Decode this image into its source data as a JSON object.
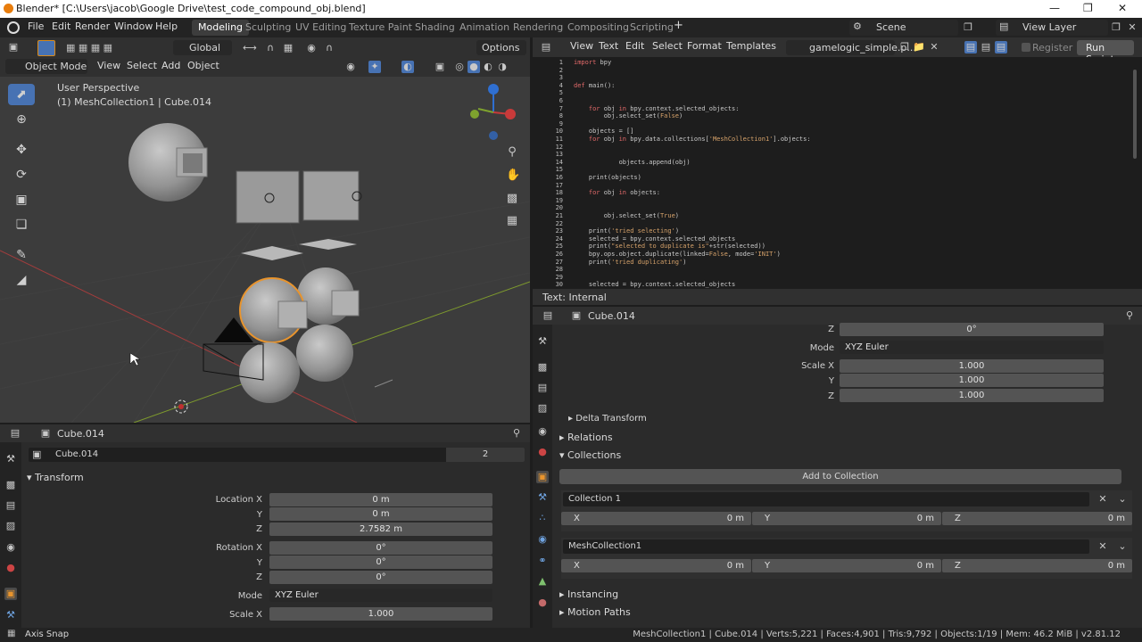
{
  "title": "Blender* [C:\\Users\\jacob\\Google Drive\\test_code_compound_obj.blend]",
  "menu": [
    "File",
    "Edit",
    "Render",
    "Window",
    "Help"
  ],
  "workspaces": [
    "Modeling",
    "Sculpting",
    "UV Editing",
    "Texture Paint",
    "Shading",
    "Animation",
    "Rendering",
    "Compositing",
    "Scripting"
  ],
  "scene": "Scene",
  "view_layer": "View Layer",
  "vp": {
    "orientation": "Global",
    "options": "Options",
    "mode": "Object Mode",
    "menus": [
      "View",
      "Select",
      "Add",
      "Object"
    ],
    "perspective": "User Perspective",
    "collection_line": "(1) MeshCollection1 | Cube.014"
  },
  "te": {
    "menus": [
      "View",
      "Text",
      "Edit",
      "Select",
      "Format",
      "Templates"
    ],
    "file": "gamelogic_simple.p...",
    "register": "Register",
    "run": "Run Script",
    "status": "Text: Internal"
  },
  "code": [
    {
      "n": "1",
      "t": "import bpy"
    },
    {
      "n": "2",
      "t": ""
    },
    {
      "n": "3",
      "t": ""
    },
    {
      "n": "4",
      "t": "def main():"
    },
    {
      "n": "5",
      "t": ""
    },
    {
      "n": "6",
      "t": ""
    },
    {
      "n": "7",
      "t": "    for obj in bpy.context.selected_objects:"
    },
    {
      "n": "8",
      "t": "        obj.select_set(False)"
    },
    {
      "n": "9",
      "t": ""
    },
    {
      "n": "10",
      "t": "    objects = []"
    },
    {
      "n": "11",
      "t": "    for obj in bpy.data.collections['MeshCollection1'].objects:"
    },
    {
      "n": "12",
      "t": ""
    },
    {
      "n": "13",
      "t": ""
    },
    {
      "n": "14",
      "t": "            objects.append(obj)"
    },
    {
      "n": "15",
      "t": ""
    },
    {
      "n": "16",
      "t": "    print(objects)"
    },
    {
      "n": "17",
      "t": ""
    },
    {
      "n": "18",
      "t": "    for obj in objects:"
    },
    {
      "n": "19",
      "t": ""
    },
    {
      "n": "20",
      "t": ""
    },
    {
      "n": "21",
      "t": "        obj.select_set(True)"
    },
    {
      "n": "22",
      "t": ""
    },
    {
      "n": "23",
      "t": "    print('tried selecting')"
    },
    {
      "n": "24",
      "t": "    selected = bpy.context.selected_objects"
    },
    {
      "n": "25",
      "t": "    print(\"selected to duplicate is\"+str(selected))"
    },
    {
      "n": "26",
      "t": "    bpy.ops.object.duplicate(linked=False, mode='INIT')"
    },
    {
      "n": "27",
      "t": "    print('tried duplicating')"
    },
    {
      "n": "28",
      "t": ""
    },
    {
      "n": "29",
      "t": ""
    },
    {
      "n": "30",
      "t": "    selected = bpy.context.selected_objects"
    }
  ],
  "props_right": {
    "object": "Cube.014",
    "z_label": "Z",
    "z_value": "0°",
    "mode_label": "Mode",
    "mode_value": "XYZ Euler",
    "scale": [
      {
        "label": "Scale X",
        "value": "1.000"
      },
      {
        "label": "Y",
        "value": "1.000"
      },
      {
        "label": "Z",
        "value": "1.000"
      }
    ],
    "delta": "Delta Transform",
    "relations": "Relations",
    "collections": "Collections",
    "add_collection": "Add to Collection",
    "col_entries": [
      {
        "name": "Collection 1",
        "x": "0 m",
        "y": "0 m",
        "z": "0 m"
      },
      {
        "name": "MeshCollection1",
        "x": "0 m",
        "y": "0 m",
        "z": "0 m"
      }
    ],
    "axis": [
      "X",
      "Y",
      "Z"
    ],
    "instancing": "Instancing",
    "motion": "Motion Paths"
  },
  "props_left": {
    "object": "Cube.014",
    "datablock": "Cube.014",
    "users": "2",
    "transform": "Transform",
    "rows": [
      {
        "label": "Location X",
        "value": "0 m"
      },
      {
        "label": "Y",
        "value": "0 m"
      },
      {
        "label": "Z",
        "value": "2.7582 m"
      },
      {
        "label": "Rotation X",
        "value": "0°"
      },
      {
        "label": "Y",
        "value": "0°"
      },
      {
        "label": "Z",
        "value": "0°"
      }
    ],
    "mode_label": "Mode",
    "mode_value": "XYZ Euler",
    "scale_label": "Scale X",
    "scale_value": "1.000"
  },
  "status": {
    "left": "Axis Snap",
    "right": "MeshCollection1 | Cube.014 | Verts:5,221 | Faces:4,901 | Tris:9,792 | Objects:1/19 | Mem: 46.2 MiB | v2.81.12"
  }
}
